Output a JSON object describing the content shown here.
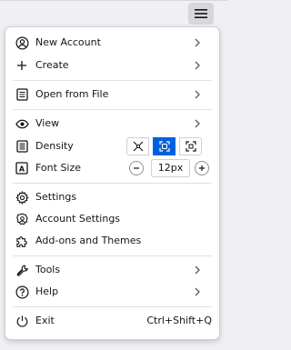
{
  "toolbar": {
    "menu_button_icon": "hamburger-icon"
  },
  "menu": {
    "new_account": {
      "label": "New Account",
      "icon": "account-icon"
    },
    "create": {
      "label": "Create",
      "icon": "plus-icon"
    },
    "open_from_file": {
      "label": "Open from File",
      "icon": "file-icon"
    },
    "view": {
      "label": "View",
      "icon": "eye-icon"
    },
    "density": {
      "label": "Density",
      "icon": "density-icon",
      "options": [
        "compact",
        "normal",
        "touch"
      ],
      "selected": "normal"
    },
    "font_size": {
      "label": "Font Size",
      "icon": "font-icon",
      "value": "12px"
    },
    "settings": {
      "label": "Settings",
      "icon": "gear-icon"
    },
    "account_settings": {
      "label": "Account Settings",
      "icon": "account-settings-icon"
    },
    "addons": {
      "label": "Add-ons and Themes",
      "icon": "puzzle-icon"
    },
    "tools": {
      "label": "Tools",
      "icon": "wrench-icon"
    },
    "help": {
      "label": "Help",
      "icon": "help-icon"
    },
    "exit": {
      "label": "Exit",
      "icon": "power-icon",
      "shortcut": "Ctrl+Shift+Q"
    }
  },
  "colors": {
    "accent": "#0061e0",
    "text": "#15141a",
    "separator": "#e0e0e6"
  }
}
